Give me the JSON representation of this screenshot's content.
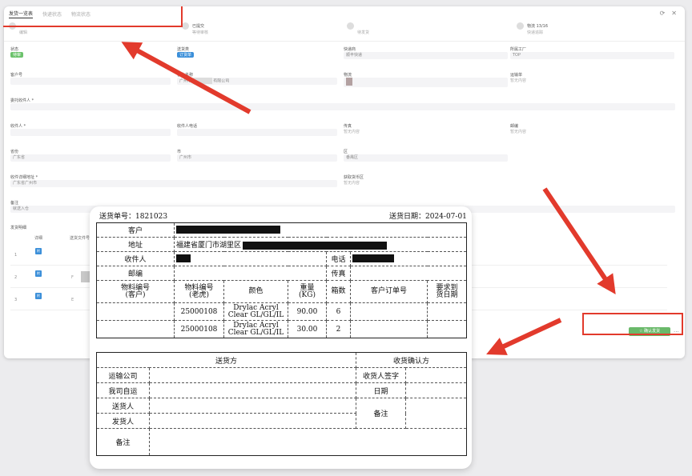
{
  "app": {
    "tabs": [
      "发货一览表",
      "快递状态",
      "物流状态"
    ],
    "steps": [
      {
        "title": "",
        "sub": "编辑"
      },
      {
        "title": "已提交",
        "sub": "等待审核"
      },
      {
        "title": "",
        "sub": "待发货"
      },
      {
        "title": "物流 13/16",
        "sub": "快递追踪"
      }
    ],
    "fields": {
      "status": {
        "label": "状态",
        "value": "待审"
      },
      "send_type": {
        "label": "送货类",
        "value": "订货单"
      },
      "express_co": {
        "label": "快递商",
        "value": "顺丰快递"
      },
      "factory": {
        "label": "所属工厂",
        "value": "TOP"
      },
      "customer_no": {
        "label": "客户号",
        "value": ""
      },
      "customer_name": {
        "label": "客户名称",
        "value": "广州市",
        "value2": "有限公司"
      },
      "tracking": {
        "label": "物流",
        "value": ""
      },
      "tracking_no": {
        "label": "运输单",
        "value": "暂无内容"
      },
      "entrust": {
        "label": "委托收件人 *",
        "value": ""
      },
      "receiver": {
        "label": "收件人 *",
        "value": ""
      },
      "receiver_phone": {
        "label": "收件人电话",
        "value": ""
      },
      "fax": {
        "label": "传真",
        "value": "暂无内容"
      },
      "postcode": {
        "label": "邮编",
        "value": "暂无内容"
      },
      "province": {
        "label": "省份",
        "value": "广东省"
      },
      "city": {
        "label": "市",
        "value": "广州市"
      },
      "district": {
        "label": "区",
        "value": "番禺区"
      },
      "address": {
        "label": "收件详细地址 *",
        "value": "广东省广州市"
      },
      "pickup": {
        "label": "获取货币区",
        "value": "暂无内容"
      },
      "remark": {
        "label": "备注",
        "value": "就送入仓"
      }
    },
    "sub_section": "发货明细",
    "sub_headers": [
      "详细",
      "送货文件号"
    ],
    "sub_rows": [
      {
        "idx": "1",
        "icon": "附",
        "cell": ""
      },
      {
        "idx": "2",
        "icon": "附",
        "cell": "F"
      },
      {
        "idx": "3",
        "icon": "附",
        "cell": "E"
      }
    ],
    "confirm_button": "☆ 确认发货",
    "more_button": "..."
  },
  "sheet": {
    "order_label": "送货单号：1821023",
    "date_label": "送货日期：2024-07-01",
    "customer_label": "客户",
    "address_label": "地址",
    "address_value": "福建省厦门市湖里区",
    "receiver_label": "收件人",
    "phone_label": "电话",
    "postcode_label": "邮编",
    "fax_label": "传真",
    "headers": [
      "物料编号\n(客户)",
      "物料编号\n(老虎)",
      "颜色",
      "重量\n(KG)",
      "箱数",
      "客户订单号",
      "要求到\n货日期"
    ],
    "rows": [
      {
        "cust_code": "",
        "tiger_code": "25000108",
        "color": "Drylac Acryl Clear GL/GL/IL",
        "weight": "90.00",
        "boxes": "6",
        "order_no": "",
        "date": ""
      },
      {
        "cust_code": "",
        "tiger_code": "25000108",
        "color": "Drylac Acryl Clear GL/GL/IL",
        "weight": "30.00",
        "boxes": "2",
        "order_no": "",
        "date": ""
      }
    ],
    "sender_header": "送货方",
    "receiver_header": "收货确认方",
    "transport_label": "运输公司",
    "self_deliver_label": "我司自运",
    "deliverer_label": "送货人",
    "shipper_label": "发货人",
    "remark_label": "备注",
    "sign_label": "收货人签字",
    "date_label2": "日期",
    "remark_label2": "备注"
  },
  "colors": {
    "annotation": "#e23a2c",
    "confirm": "#6ab96a",
    "tag_green": "#6cc26c",
    "tag_blue": "#3b8fd9"
  }
}
